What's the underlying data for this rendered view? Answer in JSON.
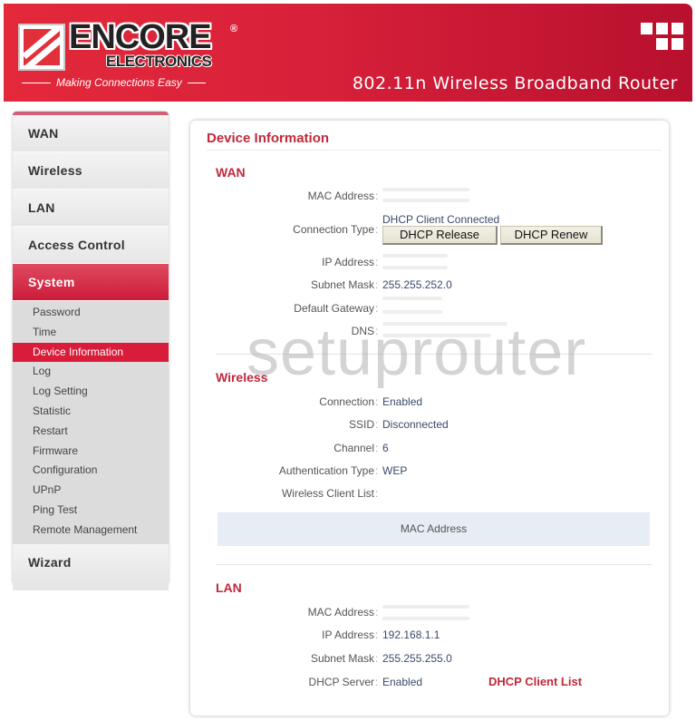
{
  "header": {
    "brand_name": "ENCORE",
    "brand_registered": "®",
    "brand_sub": "ELECTRONICS",
    "tagline": "Making Connections Easy",
    "product_title": "802.11n Wireless Broadband Router",
    "colors": {
      "brand_red": "#d8203a",
      "accent_dark_red": "#b8102e"
    }
  },
  "sidebar": {
    "main_items": [
      {
        "label": "WAN",
        "active": false
      },
      {
        "label": "Wireless",
        "active": false
      },
      {
        "label": "LAN",
        "active": false
      },
      {
        "label": "Access Control",
        "active": false
      },
      {
        "label": "System",
        "active": true
      }
    ],
    "sub_items": [
      {
        "label": "Password",
        "active": false
      },
      {
        "label": "Time",
        "active": false
      },
      {
        "label": "Device Information",
        "active": true
      },
      {
        "label": "Log",
        "active": false
      },
      {
        "label": "Log Setting",
        "active": false
      },
      {
        "label": "Statistic",
        "active": false
      },
      {
        "label": "Restart",
        "active": false
      },
      {
        "label": "Firmware",
        "active": false
      },
      {
        "label": "Configuration",
        "active": false
      },
      {
        "label": "UPnP",
        "active": false
      },
      {
        "label": "Ping Test",
        "active": false
      },
      {
        "label": "Remote Management",
        "active": false
      }
    ],
    "wizard_label": "Wizard"
  },
  "main": {
    "page_title": "Device Information",
    "colon": ":",
    "wan": {
      "title": "WAN",
      "mac_address_label": "MAC Address",
      "connection_type_label": "Connection Type",
      "connection_type_value": "DHCP Client Connected",
      "dhcp_release_button": "DHCP Release",
      "dhcp_renew_button": "DHCP Renew",
      "ip_address_label": "IP Address",
      "subnet_mask_label": "Subnet Mask",
      "subnet_mask_value": "255.255.252.0",
      "default_gateway_label": "Default Gateway",
      "dns_label": "DNS"
    },
    "wireless": {
      "title": "Wireless",
      "connection_label": "Connection",
      "connection_value": "Enabled",
      "ssid_label": "SSID",
      "ssid_value": "Disconnected",
      "channel_label": "Channel",
      "channel_value": "6",
      "auth_type_label": "Authentication Type",
      "auth_type_value": "WEP",
      "client_list_label": "Wireless Client List",
      "client_table_header": "MAC Address"
    },
    "lan": {
      "title": "LAN",
      "mac_address_label": "MAC Address",
      "ip_address_label": "IP Address",
      "ip_address_value": "192.168.1.1",
      "subnet_mask_label": "Subnet Mask",
      "subnet_mask_value": "255.255.255.0",
      "dhcp_server_label": "DHCP Server",
      "dhcp_server_value": "Enabled",
      "dhcp_client_list_link": "DHCP Client List"
    }
  },
  "watermark": "setuprouter"
}
